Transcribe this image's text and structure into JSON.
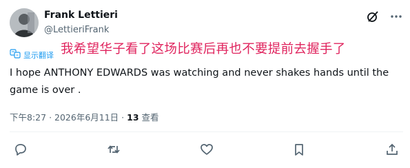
{
  "author": {
    "name": "Frank Lettieri",
    "handle": "@LettieriFrank"
  },
  "translate": {
    "label": "显示翻译"
  },
  "translation_overlay": "我希望华子看了这场比赛后再也不要提前去握手了",
  "tweet": {
    "text": "I hope ANTHONY EDWARDS was watching and never shakes hands until the game is over ."
  },
  "meta": {
    "time": "下午8:27",
    "date": "2026年6月11日",
    "views_count": "13",
    "views_label": "查看"
  },
  "icons": {
    "top": [
      "grok-icon",
      "more-icon"
    ],
    "actions": [
      "reply-icon",
      "retweet-icon",
      "like-icon",
      "bookmark-icon",
      "share-icon"
    ]
  },
  "colors": {
    "link": "#1d9bf0",
    "secondary": "#536471",
    "overlay_red": "#e0245e"
  }
}
